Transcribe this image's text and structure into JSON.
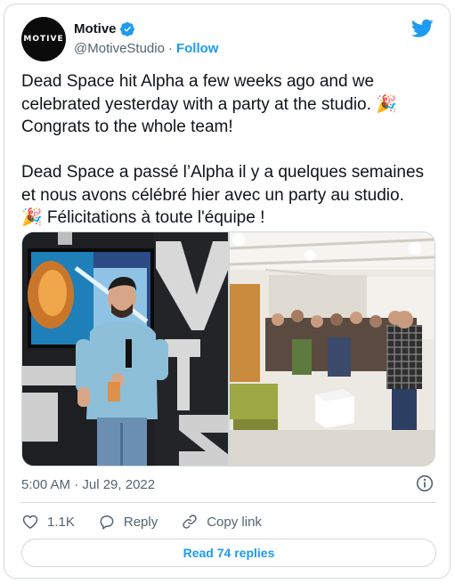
{
  "author": {
    "avatar_text": "MOTIVE",
    "display_name": "Motive",
    "handle": "@MotiveStudio",
    "separator": "·",
    "follow_label": "Follow",
    "verified_icon": "verified-badge-icon"
  },
  "brand_icon": "twitter-bird-icon",
  "tweet": {
    "text": "Dead Space hit Alpha a few weeks ago and we celebrated yesterday with a party at the studio. 🎉\nCongrats to the whole team!\n\nDead Space a passé l’Alpha il y a quelques semaines et nous avons célébré hier avec un party au studio.\n🎉 Félicitations à toute l'équipe !",
    "photos": [
      "photo-man-presenting",
      "photo-studio-party"
    ]
  },
  "meta": {
    "timestamp": "5:00 AM · Jul 29, 2022"
  },
  "actions": {
    "likes_count": "1.1K",
    "reply_label": "Reply",
    "copy_link_label": "Copy link"
  },
  "read_replies_label": "Read 74 replies",
  "colors": {
    "accent": "#1d9bf0",
    "text": "#0f1419",
    "muted": "#536471",
    "border": "#cfd9de"
  }
}
